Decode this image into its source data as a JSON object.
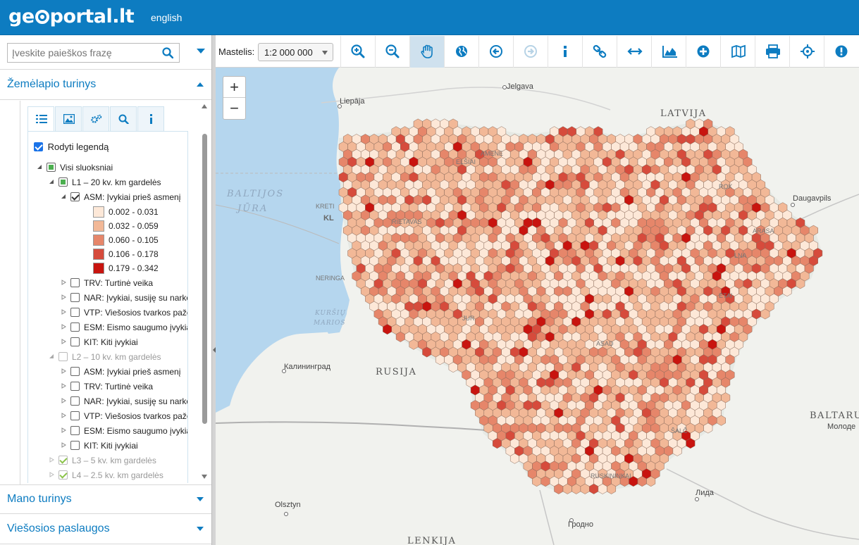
{
  "header": {
    "logo_text": "geoportal.lt",
    "language_link": "english"
  },
  "search": {
    "placeholder": "Įveskite paieškos frazę"
  },
  "sections": {
    "map_content": "Žemėlapio turinys",
    "my_content": "Mano turinys",
    "public_services": "Viešosios paslaugos"
  },
  "tabs": [
    "layers-icon",
    "image-icon",
    "settings-icon",
    "search-icon",
    "info-icon"
  ],
  "legend_toggle": "Rodyti legendą",
  "tree": {
    "all_layers": "Visi sluoksniai",
    "l1": "L1 – 20 kv. km gardelės",
    "l1_items": [
      "ASM: Įvykiai prieš asmenį",
      "TRV: Turtinė veika",
      "NAR: Įvykiai, susiję su narkotikais",
      "VTP: Viešosios tvarkos pažeidimai",
      "ESM: Eismo saugumo įvykiai",
      "KIT: Kiti įvykiai"
    ],
    "l2": "L2 – 10 kv. km gardelės",
    "l2_items": [
      "ASM: Įvykiai prieš asmenį",
      "TRV: Turtinė veika",
      "NAR: Įvykiai, susiję su narkotikais",
      "VTP: Viešosios tvarkos pažeidimai",
      "ESM: Eismo saugumo įvykiai",
      "KIT: Kiti įvykiai"
    ],
    "l3": "L3 – 5 kv. km gardelės",
    "l4": "L4 – 2.5 kv. km gardelės"
  },
  "legend": [
    {
      "range": "0.002 - 0.031",
      "color": "#fde8d8"
    },
    {
      "range": "0.032 - 0.059",
      "color": "#f2b897"
    },
    {
      "range": "0.060 - 0.105",
      "color": "#e6866a"
    },
    {
      "range": "0.106 - 0.178",
      "color": "#d64b3c"
    },
    {
      "range": "0.179 - 0.342",
      "color": "#c8140f"
    }
  ],
  "toolbar": {
    "scale_label": "Mastelis:",
    "scale_value": "1:2 000 000",
    "tools": [
      "zoom-in-icon",
      "zoom-out-icon",
      "pan-hand-icon",
      "globe-icon",
      "back-icon",
      "forward-icon",
      "info-icon",
      "link-icon",
      "measure-distance-icon",
      "profile-chart-icon",
      "add-icon",
      "map-icon",
      "print-icon",
      "locate-icon",
      "alert-icon"
    ]
  },
  "map": {
    "zoom_in": "+",
    "zoom_out": "−",
    "labels": {
      "jelgava": "Jelgava",
      "liepaja": "Liepāja",
      "latvija": "LATVIJA",
      "baltijos": "BALTIJOS",
      "jura": "JŪRA",
      "daugavpils": "Daugavpils",
      "kurs1": "KURŠIŲ",
      "kurs2": "MARIOS",
      "kaliningrad": "Калининград",
      "rusija": "RUSIJA",
      "baltarus": "BALTARUS",
      "molodo": "Молоде",
      "lida": "Лида",
      "olsztyn": "Olsztyn",
      "grodno": "Гродно",
      "lenkija": "LENKIJA",
      "kretinga": "KRETI",
      "kl": "KL",
      "neringa": "NERINGA",
      "telsiai": "ELŠIAI",
      "mazeikiai": "AMENE",
      "rokiskis": "ROK",
      "zarasai": "ARASA",
      "utena": "ETAI",
      "jurbarkas": "JUR",
      "druskininkai": "RUSKININKAI",
      "salcininkai": "ŠALČ",
      "kasiad": "ASAD",
      "plunge": "RIETAVAS",
      "ignalina": "LNA"
    }
  }
}
